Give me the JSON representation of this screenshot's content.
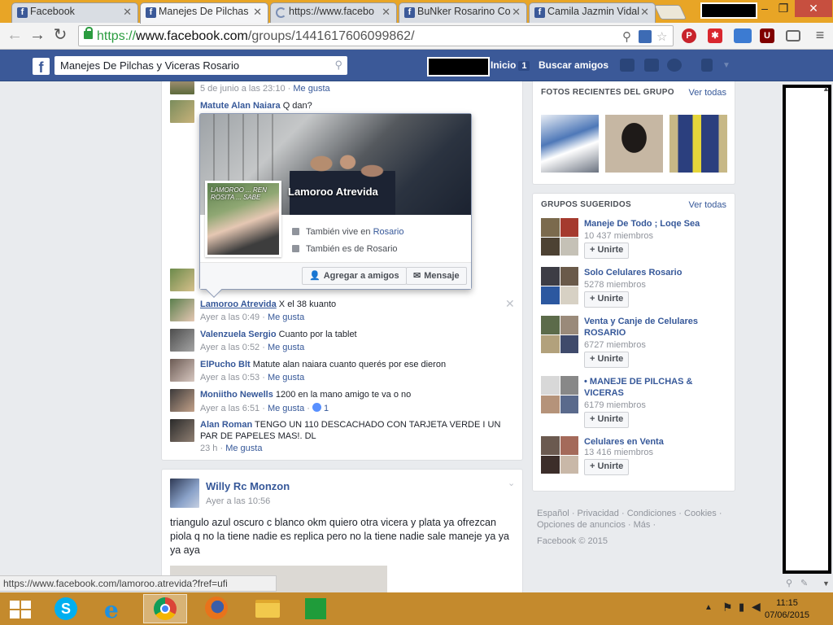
{
  "browser": {
    "tabs": [
      {
        "title": "Facebook",
        "active": false
      },
      {
        "title": "Manejes De Pilchas",
        "active": true
      },
      {
        "title": "https://www.facebo",
        "active": false
      },
      {
        "title": "BuNker Rosarino Co",
        "active": false
      },
      {
        "title": "Camila Jazmin Vidal",
        "active": false
      }
    ],
    "url_scheme": "https://",
    "url_host": "www.facebook.com",
    "url_path": "/groups/1441617606099862/",
    "status_url": "https://www.facebook.com/lamoroo.atrevida?fref=ufi"
  },
  "fb": {
    "search_value": "Manejes De Pilchas y Viceras Rosario",
    "nav_home": "Inicio",
    "nav_home_count": "1",
    "nav_find_friends": "Buscar amigos"
  },
  "feed": {
    "top_meta_time": "5 de junio a las 23:10",
    "like": "Me gusta",
    "comments": [
      {
        "name": "Matute Alan Naiara",
        "text": "Q dan?"
      },
      {
        "name": "Lamoroo Atrevida",
        "text": "X el 38 kuanto",
        "time": "Ayer a las 0:49"
      },
      {
        "name": "Valenzuela Sergio",
        "text": "Cuanto por la tablet",
        "time": "Ayer a las 0:52"
      },
      {
        "name": "ElPucho Blt",
        "text": "Matute alan naiara cuanto querés por ese dieron",
        "time": "Ayer a las 0:53"
      },
      {
        "name": "Moniitho Newells",
        "text": "1200 en la mano amigo te va o no",
        "time": "Ayer a las 6:51",
        "likes": "1"
      },
      {
        "name": "Alan Roman",
        "text": "TENGO UN 110 DESCACHADO CON TARJETA VERDE I UN PAR DE PAPELES MAS!. DL",
        "time": "23 h"
      }
    ],
    "post2": {
      "author": "Willy Rc Monzon",
      "time": "Ayer a las 10:56",
      "text": "triangulo azul oscuro c blanco okm quiero otra vicera y plata ya ofrezcan piola q no la tiene nadie es replica pero no la tiene nadie sale maneje ya ya ya aya"
    }
  },
  "hovercard": {
    "name": "Lamoroo Atrevida",
    "pic_text": "LAMOROO ... REN ROSITA ... SABE",
    "lives_prefix": "También vive en",
    "lives_city": "Rosario",
    "from": "También es de Rosario",
    "add_friend": "Agregar a amigos",
    "message": "Mensaje"
  },
  "sidebar": {
    "photos_title": "FOTOS RECIENTES DEL GRUPO",
    "see_all": "Ver todas",
    "groups_title": "GRUPOS SUGERIDOS",
    "join": "+ Unirte",
    "groups": [
      {
        "name": "Maneje De Todo ; Loqe Sea",
        "members": "10 437 miembros"
      },
      {
        "name": "Solo Celulares Rosario",
        "members": "5278 miembros"
      },
      {
        "name": "Venta y Canje de Celulares ROSARIO",
        "members": "6727 miembros"
      },
      {
        "name": "• MANEJE DE PILCHAS & VICERAS",
        "members": "6179 miembros"
      },
      {
        "name": "Celulares en Venta",
        "members": "13 416 miembros"
      }
    ],
    "footer": {
      "l1": "Español",
      "l2": "Privacidad",
      "l3": "Condiciones",
      "l4": "Cookies",
      "l5": "Opciones de anuncios",
      "l6": "Más",
      "copyright": "Facebook © 2015"
    }
  },
  "taskbar": {
    "time": "11:15",
    "date": "07/06/2015"
  }
}
